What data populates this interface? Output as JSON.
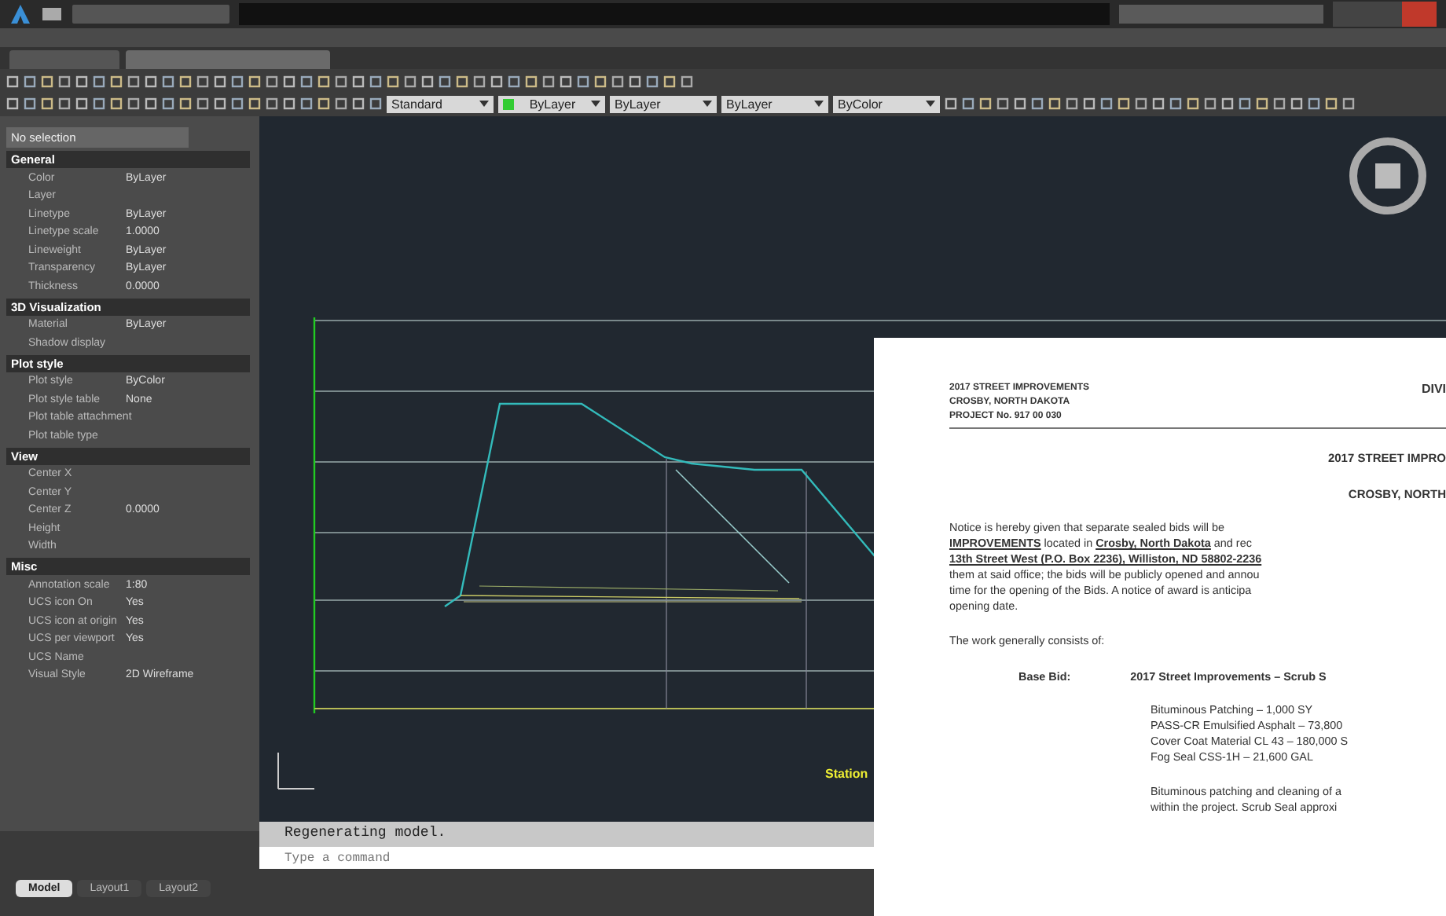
{
  "toolbar": {
    "dropdowns": [
      {
        "value": "Standard",
        "kind": "plain"
      },
      {
        "value": "ByLayer",
        "kind": "layer"
      },
      {
        "value": "ByLayer",
        "kind": "plain"
      },
      {
        "value": "ByLayer",
        "kind": "plain"
      },
      {
        "value": "ByColor",
        "kind": "plain"
      }
    ]
  },
  "properties": {
    "selection": "No selection",
    "sections": [
      {
        "title": "General",
        "rows": [
          {
            "label": "Color",
            "value": "ByLayer"
          },
          {
            "label": "Layer"
          },
          {
            "label": "Linetype",
            "value": "ByLayer"
          },
          {
            "label": "Linetype scale",
            "value": "1.0000"
          },
          {
            "label": "Lineweight",
            "value": "ByLayer"
          },
          {
            "label": "Transparency",
            "value": "ByLayer"
          },
          {
            "label": "Thickness",
            "value": "0.0000"
          }
        ]
      },
      {
        "title": "3D Visualization",
        "rows": [
          {
            "label": "Material",
            "value": "ByLayer"
          },
          {
            "label": "Shadow display"
          }
        ]
      },
      {
        "title": "Plot style",
        "rows": [
          {
            "label": "Plot style",
            "value": "ByColor"
          },
          {
            "label": "Plot style table",
            "value": "None"
          },
          {
            "label": "Plot table attachment"
          },
          {
            "label": "Plot table type"
          }
        ]
      },
      {
        "title": "View",
        "rows": [
          {
            "label": "Center X"
          },
          {
            "label": "Center Y"
          },
          {
            "label": "Center Z",
            "value": "0.0000"
          },
          {
            "label": "Height"
          },
          {
            "label": "Width"
          }
        ]
      },
      {
        "title": "Misc",
        "rows": [
          {
            "label": "Annotation scale",
            "value": "1:80"
          },
          {
            "label": "UCS icon On",
            "value": "Yes"
          },
          {
            "label": "UCS icon at origin",
            "value": "Yes"
          },
          {
            "label": "UCS per viewport",
            "value": "Yes"
          },
          {
            "label": "UCS Name"
          },
          {
            "label": "Visual Style",
            "value": "2D Wireframe"
          }
        ]
      }
    ]
  },
  "canvas": {
    "x_axis_label": "Station"
  },
  "command_line": {
    "history": "Regenerating model.",
    "placeholder": "Type a command"
  },
  "layout_tabs": [
    {
      "label": "Model",
      "selected": true
    },
    {
      "label": "Layout1",
      "selected": false
    },
    {
      "label": "Layout2",
      "selected": false
    }
  ],
  "document": {
    "header_lines": [
      "2017 STREET IMPROVEMENTS",
      "CROSBY, NORTH DAKOTA",
      "PROJECT No. 917 00 030"
    ],
    "header_right": "DIVI",
    "titles": [
      "2017 STREET IMPRO",
      "CROSBY, NORTH"
    ],
    "paragraph": [
      "Notice is hereby given that separate sealed bids will be",
      "**IMPROVEMENTS** located in **Crosby, North Dakota** and rec",
      "**13th Street West (P.O. Box 2236), Williston, ND 58802-2236**",
      "them at said office; the bids will be publicly opened and annou",
      "time for the opening of the Bids. A notice of award is anticipa",
      "opening date."
    ],
    "intro": "The work generally consists of:",
    "bid_label": "Base Bid:",
    "bid_title": "2017 Street Improvements – Scrub S",
    "items": [
      "Bituminous Patching – 1,000 SY",
      "PASS-CR Emulsified Asphalt – 73,800",
      "Cover Coat Material CL 43 – 180,000 S",
      "Fog Seal CSS-1H – 21,600 GAL"
    ],
    "closing": [
      "Bituminous patching and cleaning of a",
      "within the project. Scrub Seal approxi"
    ]
  }
}
